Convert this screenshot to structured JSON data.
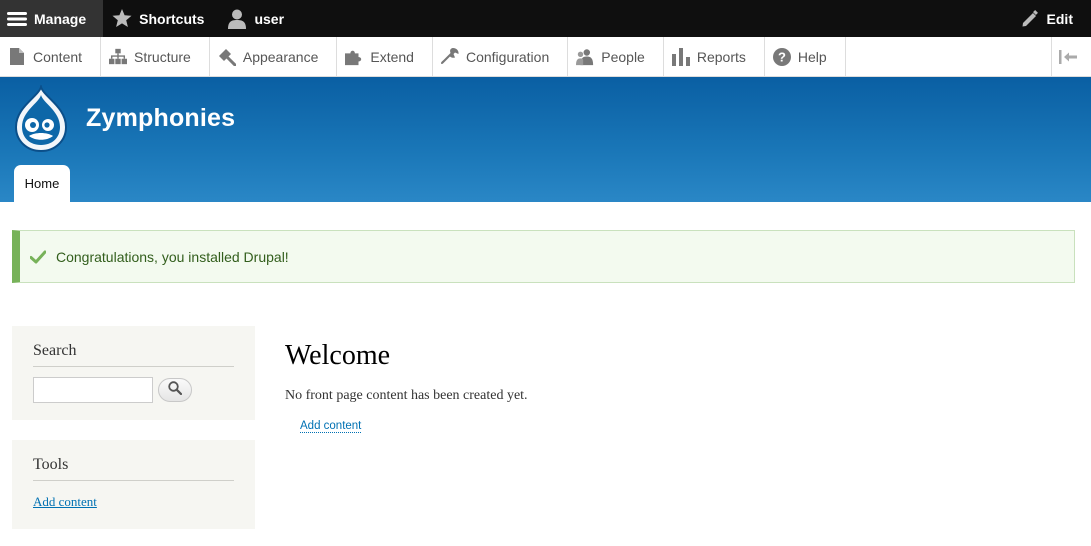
{
  "toolbar": {
    "manage": {
      "label": "Manage",
      "icon": "menu-icon"
    },
    "shortcuts": {
      "label": "Shortcuts",
      "icon": "star-icon"
    },
    "user": {
      "label": "user",
      "icon": "user-icon"
    },
    "edit": {
      "label": "Edit",
      "icon": "pencil-icon"
    }
  },
  "tray": {
    "items": [
      {
        "label": "Content",
        "icon": "file-icon"
      },
      {
        "label": "Structure",
        "icon": "sitemap-icon"
      },
      {
        "label": "Appearance",
        "icon": "paintbrush-icon"
      },
      {
        "label": "Extend",
        "icon": "puzzle-icon"
      },
      {
        "label": "Configuration",
        "icon": "wrench-icon"
      },
      {
        "label": "People",
        "icon": "people-icon"
      },
      {
        "label": "Reports",
        "icon": "bar-chart-icon"
      },
      {
        "label": "Help",
        "icon": "help-icon"
      }
    ]
  },
  "header": {
    "site_name": "Zymphonies",
    "home_tab": "Home"
  },
  "status": {
    "message": "Congratulations, you installed Drupal!"
  },
  "sidebar": {
    "search": {
      "title": "Search",
      "placeholder": ""
    },
    "tools": {
      "title": "Tools",
      "link": "Add content"
    }
  },
  "main": {
    "title": "Welcome",
    "text": "No front page content has been created yet.",
    "link": "Add content"
  },
  "colors": {
    "toolbar_bg": "#0f0f0f",
    "header_blue": "#1a77b8",
    "status_green": "#77b259",
    "link_blue": "#0071b3"
  }
}
